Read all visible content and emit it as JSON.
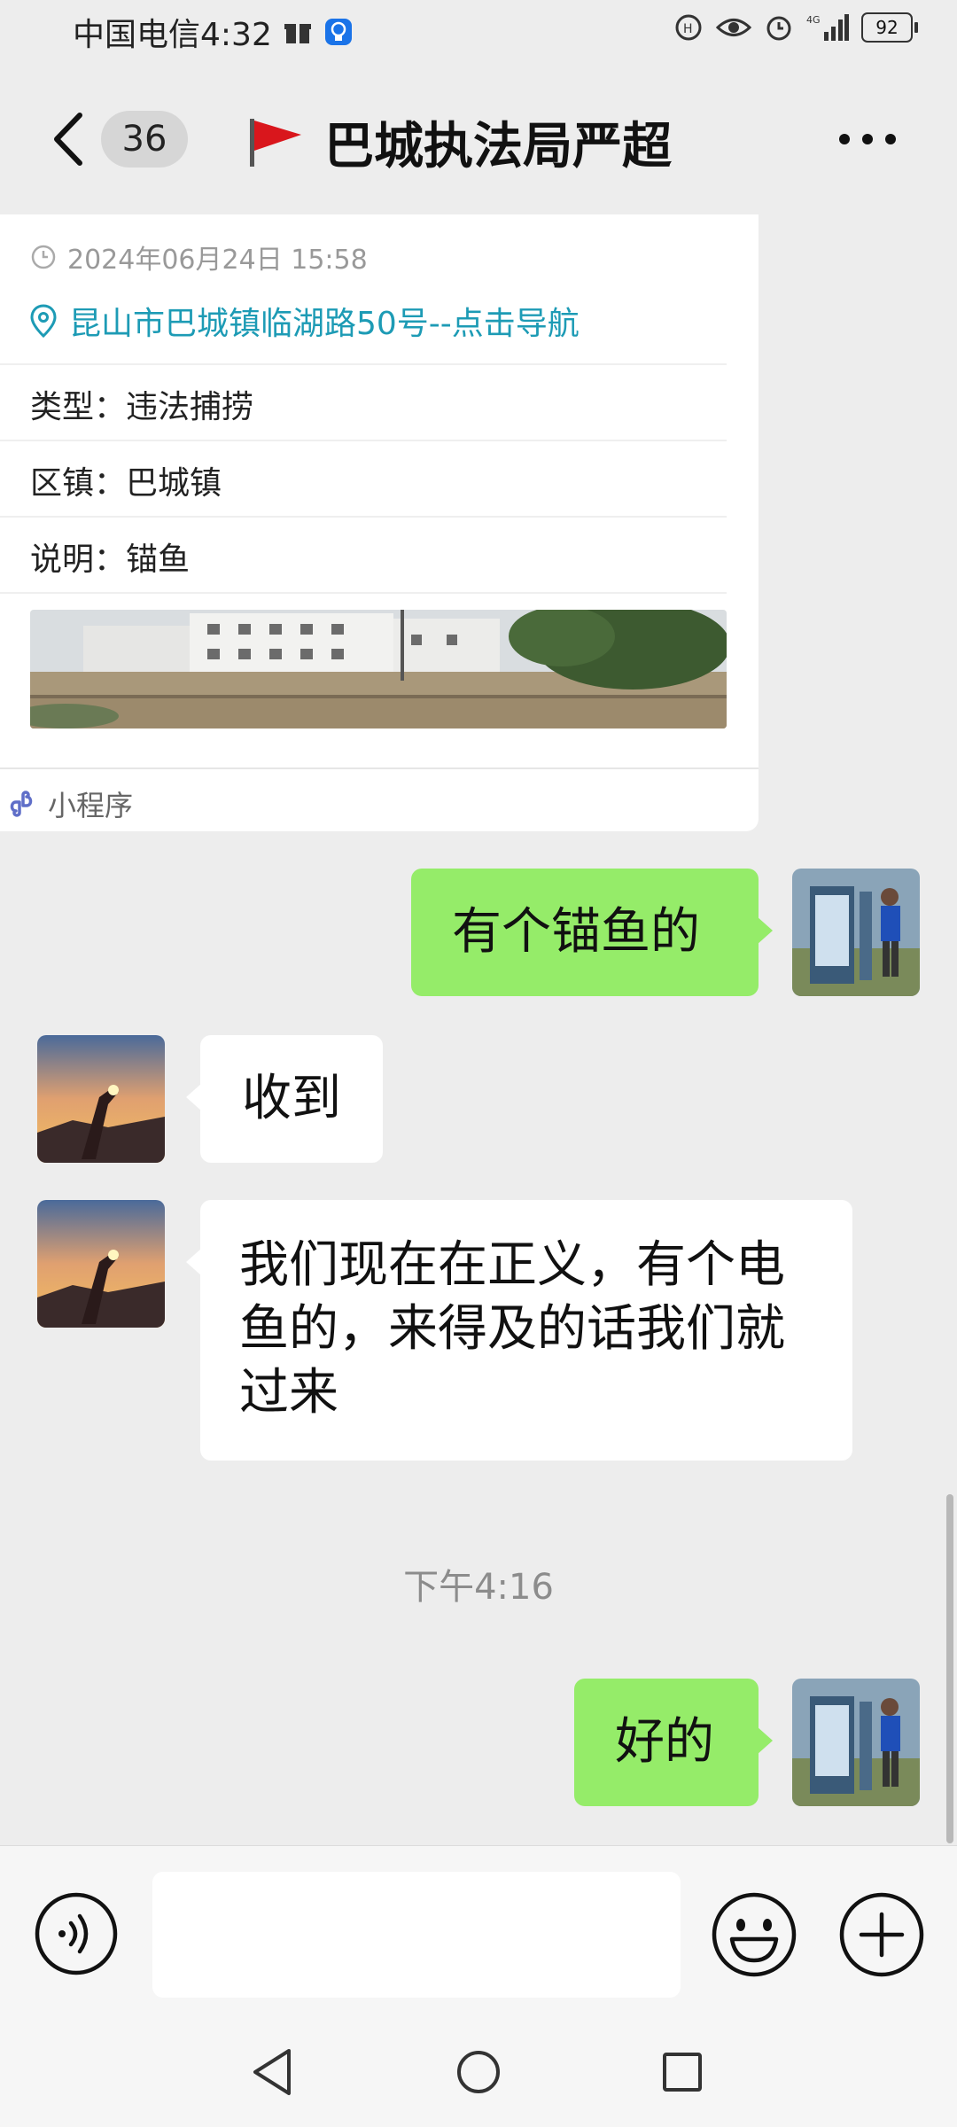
{
  "status_bar": {
    "carrier_time": "中国电信4:32",
    "battery": "92"
  },
  "header": {
    "unread_count": "36",
    "title": "巴城执法局严超"
  },
  "card": {
    "datetime": "2024年06月24日 15:58",
    "location": "昆山市巴城镇临湖路50号--点击导航",
    "rows": [
      {
        "label": "类型：",
        "value": "违法捕捞"
      },
      {
        "label": "区镇：",
        "value": "巴城镇"
      },
      {
        "label": "说明：",
        "value": "锚鱼"
      }
    ],
    "footer_label": "小程序"
  },
  "messages": [
    {
      "direction": "out",
      "text": "有个锚鱼的"
    },
    {
      "direction": "in",
      "text": "收到"
    },
    {
      "direction": "in",
      "lines": [
        "我们现在在正义，有个电",
        "鱼的，来得及的话我们就",
        "过来"
      ]
    },
    {
      "direction": "out",
      "text": "好的"
    }
  ],
  "timestamp": "下午4:16",
  "colors": {
    "outgoing_bubble": "#95ec69",
    "incoming_bubble": "#ffffff",
    "location_link": "#1d9bb5",
    "background": "#ededed"
  }
}
